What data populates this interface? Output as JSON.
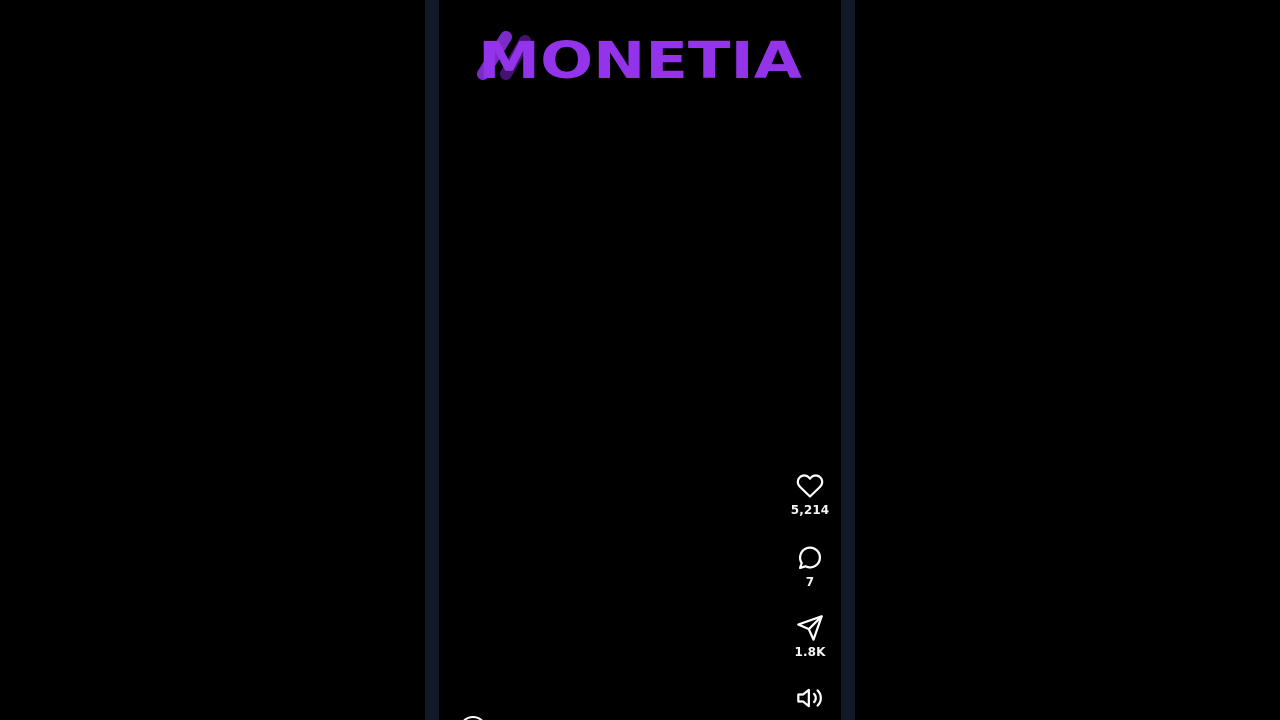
{
  "app": {
    "logo_text": "MONETIA",
    "brand_color": "#9333EA"
  },
  "video_actions": {
    "like": {
      "icon": "heart-icon",
      "count": "5,214"
    },
    "comment": {
      "icon": "comment-icon",
      "count": "7"
    },
    "share": {
      "icon": "send-icon",
      "count": "1.8K"
    },
    "sound": {
      "icon": "volume-icon"
    }
  },
  "colors": {
    "page_background": "#000000",
    "phone_frame": "#111827",
    "icon_and_text": "#FFFFFF"
  }
}
